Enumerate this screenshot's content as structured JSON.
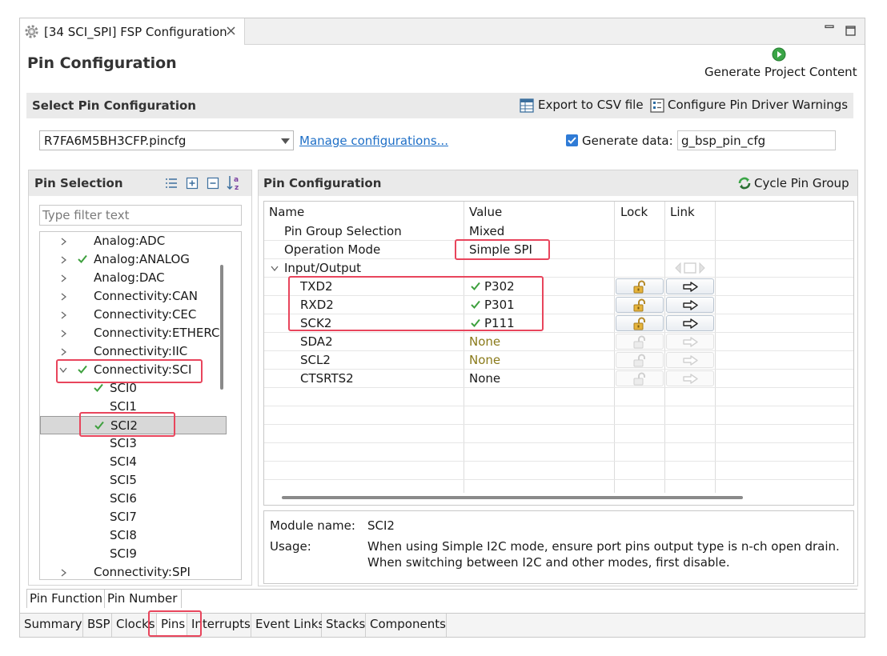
{
  "editor": {
    "tab_title": "[34 SCI_SPI] FSP Configuration"
  },
  "header": {
    "title": "Pin Configuration",
    "generate_label": "Generate Project Content"
  },
  "select_config": {
    "section_title": "Select Pin Configuration",
    "export_label": "Export to CSV file",
    "warnings_label": "Configure Pin Driver Warnings",
    "config_value": "R7FA6M5BH3CFP.pincfg",
    "manage_link": "Manage configurations...",
    "generate_data_label": "Generate data:",
    "generate_data_checked": true,
    "generate_data_value": "g_bsp_pin_cfg"
  },
  "pin_selection": {
    "title": "Pin Selection",
    "filter_placeholder": "Type filter text",
    "tree": [
      {
        "label": "Analog:ADC",
        "expandable": true,
        "expanded": false,
        "checked": false,
        "level": 0
      },
      {
        "label": "Analog:ANALOG",
        "expandable": true,
        "expanded": false,
        "checked": true,
        "level": 0
      },
      {
        "label": "Analog:DAC",
        "expandable": true,
        "expanded": false,
        "checked": false,
        "level": 0
      },
      {
        "label": "Connectivity:CAN",
        "expandable": true,
        "expanded": false,
        "checked": false,
        "level": 0
      },
      {
        "label": "Connectivity:CEC",
        "expandable": true,
        "expanded": false,
        "checked": false,
        "level": 0
      },
      {
        "label": "Connectivity:ETHERC",
        "expandable": true,
        "expanded": false,
        "checked": false,
        "level": 0
      },
      {
        "label": "Connectivity:IIC",
        "expandable": true,
        "expanded": false,
        "checked": false,
        "level": 0
      },
      {
        "label": "Connectivity:SCI",
        "expandable": true,
        "expanded": true,
        "checked": true,
        "level": 0
      },
      {
        "label": "SCI0",
        "expandable": false,
        "checked": true,
        "level": 1
      },
      {
        "label": "SCI1",
        "expandable": false,
        "checked": false,
        "level": 1
      },
      {
        "label": "SCI2",
        "expandable": false,
        "checked": true,
        "level": 1,
        "selected": true
      },
      {
        "label": "SCI3",
        "expandable": false,
        "checked": false,
        "level": 1
      },
      {
        "label": "SCI4",
        "expandable": false,
        "checked": false,
        "level": 1
      },
      {
        "label": "SCI5",
        "expandable": false,
        "checked": false,
        "level": 1
      },
      {
        "label": "SCI6",
        "expandable": false,
        "checked": false,
        "level": 1
      },
      {
        "label": "SCI7",
        "expandable": false,
        "checked": false,
        "level": 1
      },
      {
        "label": "SCI8",
        "expandable": false,
        "checked": false,
        "level": 1
      },
      {
        "label": "SCI9",
        "expandable": false,
        "checked": false,
        "level": 1
      },
      {
        "label": "Connectivity:SPI",
        "expandable": true,
        "expanded": false,
        "checked": false,
        "level": 0
      }
    ],
    "tabs": [
      "Pin Function",
      "Pin Number"
    ],
    "active_tab": "Pin Function"
  },
  "pin_config": {
    "title": "Pin Configuration",
    "cycle_label": "Cycle Pin Group",
    "columns": [
      "Name",
      "Value",
      "Lock",
      "Link"
    ],
    "rows": [
      {
        "name": "Pin Group Selection",
        "value": "Mixed",
        "indent": 1
      },
      {
        "name": "Operation Mode",
        "value": "Simple SPI",
        "indent": 1
      },
      {
        "name": "Input/Output",
        "value": "",
        "indent": 0,
        "group": true
      },
      {
        "name": "TXD2",
        "value": "P302",
        "indent": 2,
        "checked": true,
        "lock": "active",
        "link": "active"
      },
      {
        "name": "RXD2",
        "value": "P301",
        "indent": 2,
        "checked": true,
        "lock": "active",
        "link": "active"
      },
      {
        "name": "SCK2",
        "value": "P111",
        "indent": 2,
        "checked": true,
        "lock": "active",
        "link": "active"
      },
      {
        "name": "SDA2",
        "value": "None",
        "indent": 2,
        "dim": true,
        "lock": "disabled",
        "link": "disabled"
      },
      {
        "name": "SCL2",
        "value": "None",
        "indent": 2,
        "dim": true,
        "lock": "disabled",
        "link": "disabled"
      },
      {
        "name": "CTSRTS2",
        "value": "None",
        "indent": 2,
        "lock": "disabled",
        "link": "disabled"
      }
    ],
    "module_label": "Module name:",
    "module_value": "SCI2",
    "usage_label": "Usage:",
    "usage_lines": [
      "When using Simple I2C mode, ensure port pins output type is n-ch open drain.",
      "When switching between I2C and other modes, first disable."
    ]
  },
  "bottom_tabs": {
    "items": [
      "Summary",
      "BSP",
      "Clocks",
      "Pins",
      "Interrupts",
      "Event Links",
      "Stacks",
      "Components"
    ],
    "active": "Pins"
  },
  "colors": {
    "highlight": "#e8455c",
    "check": "#3ea03e",
    "link": "#1e6fc7",
    "dim_value": "#8a7a1a"
  }
}
